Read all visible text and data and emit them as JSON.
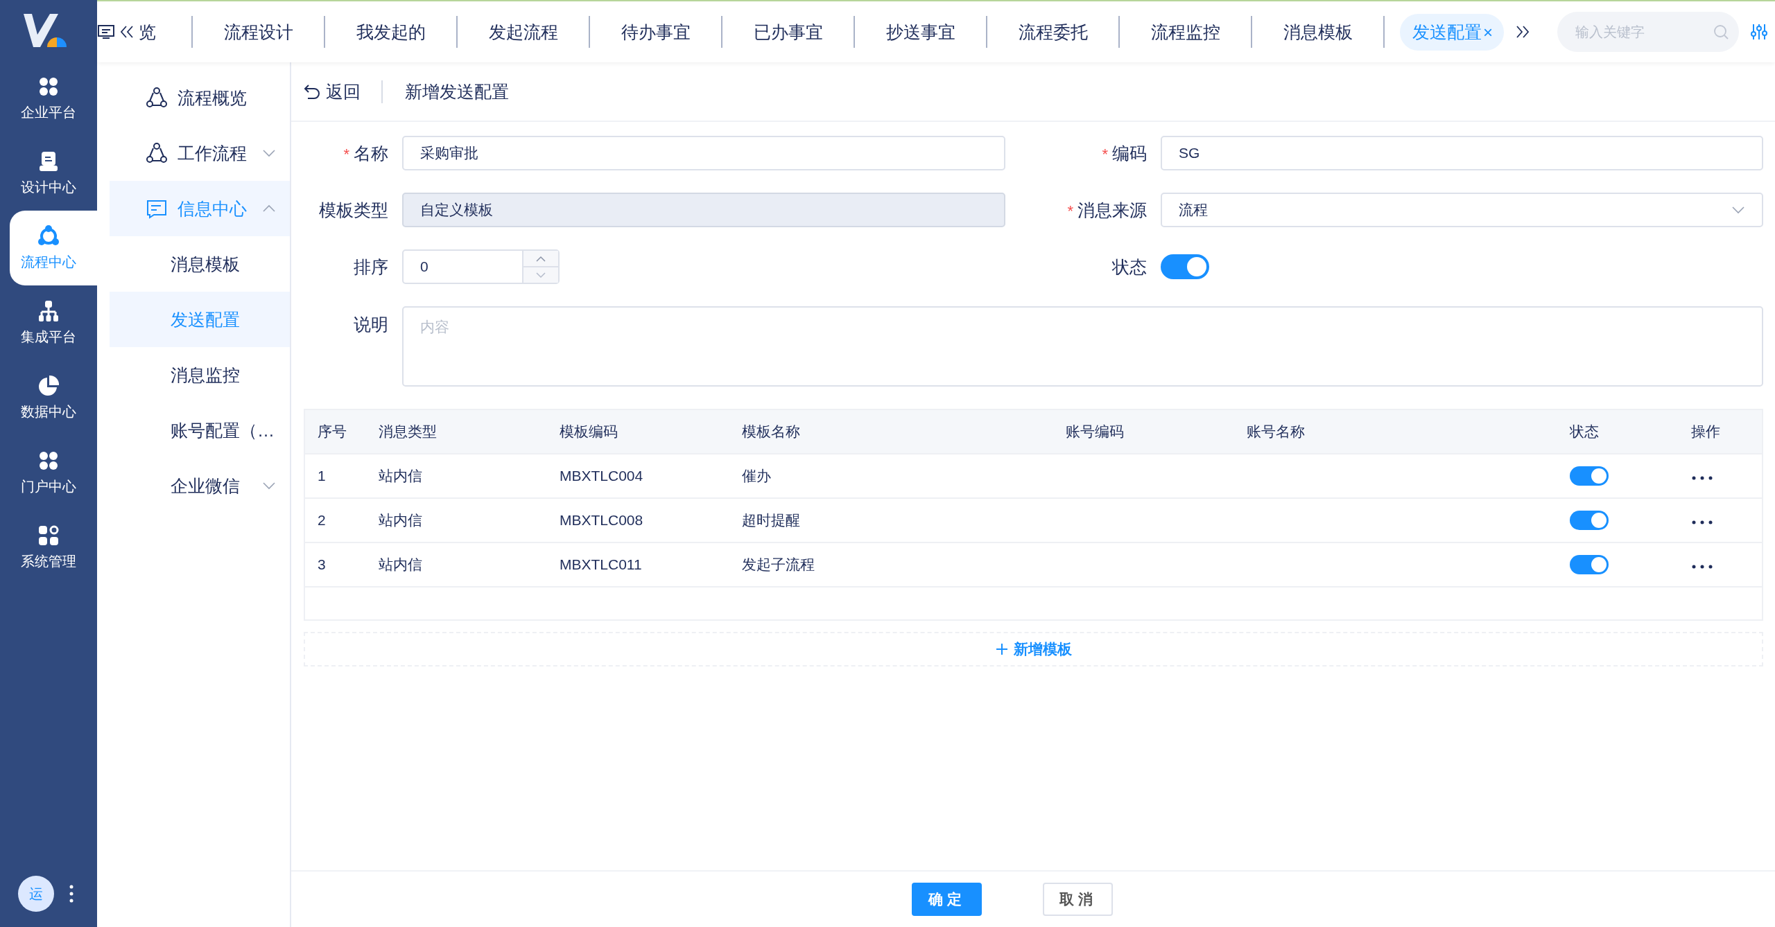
{
  "rail": {
    "items": [
      {
        "label": "企业平台",
        "kind": "grid",
        "selected": false
      },
      {
        "label": "设计中心",
        "kind": "design",
        "selected": false
      },
      {
        "label": "流程中心",
        "kind": "flow",
        "selected": true
      },
      {
        "label": "集成平台",
        "kind": "tree",
        "selected": false
      },
      {
        "label": "数据中心",
        "kind": "pie",
        "selected": false
      },
      {
        "label": "门户中心",
        "kind": "grid",
        "selected": false
      },
      {
        "label": "系统管理",
        "kind": "gear",
        "selected": false
      }
    ],
    "avatar": "运"
  },
  "tabs": [
    {
      "label": "览",
      "selected": false
    },
    {
      "label": "流程设计",
      "selected": false
    },
    {
      "label": "我发起的",
      "selected": false
    },
    {
      "label": "发起流程",
      "selected": false
    },
    {
      "label": "待办事宜",
      "selected": false
    },
    {
      "label": "已办事宜",
      "selected": false
    },
    {
      "label": "抄送事宜",
      "selected": false
    },
    {
      "label": "流程委托",
      "selected": false
    },
    {
      "label": "流程监控",
      "selected": false
    },
    {
      "label": "消息模板",
      "selected": false
    },
    {
      "label": "发送配置",
      "selected": true,
      "close": "×"
    }
  ],
  "search": {
    "placeholder": "输入关键字"
  },
  "menu": [
    {
      "label": "流程概览",
      "kind": "flow",
      "selected": false
    },
    {
      "label": "工作流程",
      "kind": "flow",
      "selected": false,
      "expanded": false
    },
    {
      "label": "信息中心",
      "kind": "message",
      "selected": true,
      "expanded": true,
      "children": [
        {
          "label": "消息模板",
          "selected": false
        },
        {
          "label": "发送配置",
          "selected": true
        },
        {
          "label": "消息监控",
          "selected": false
        },
        {
          "label": "账号配置（…",
          "selected": false
        },
        {
          "label": "企业微信",
          "selected": false,
          "expanded": false
        }
      ]
    }
  ],
  "breadcrumb": {
    "back": "返回",
    "title": "新增发送配置"
  },
  "form": {
    "fields": [
      {
        "label": "名称",
        "kind": "text",
        "required_mark": "*",
        "value": "采购审批",
        "disabled": false
      },
      {
        "label": "编码",
        "kind": "text",
        "required_mark": "*",
        "value": "SG",
        "disabled": false
      },
      {
        "label": "模板类型",
        "kind": "text",
        "value": "自定义模板",
        "disabled": true
      },
      {
        "label": "消息来源",
        "kind": "select",
        "required_mark": "*",
        "value": "流程"
      },
      {
        "label": "排序",
        "kind": "number",
        "value": "0"
      },
      {
        "label": "状态",
        "kind": "switch",
        "on": true
      },
      {
        "label": "说明",
        "kind": "textarea",
        "placeholder": "内容"
      }
    ]
  },
  "table": {
    "columns": [
      "序号",
      "消息类型",
      "模板编码",
      "模板名称",
      "账号编码",
      "账号名称",
      "状态",
      "操作"
    ],
    "rows": [
      {
        "cells": [
          "1",
          "站内信",
          "MBXTLC004",
          "催办",
          "",
          ""
        ],
        "on": true
      },
      {
        "cells": [
          "2",
          "站内信",
          "MBXTLC008",
          "超时提醒",
          "",
          ""
        ],
        "on": true
      },
      {
        "cells": [
          "3",
          "站内信",
          "MBXTLC011",
          "发起子流程",
          "",
          ""
        ],
        "on": true
      }
    ]
  },
  "add_button": {
    "label": "新增模板"
  },
  "footer": {
    "buttons": [
      {
        "label": "确定",
        "kind": "primary"
      },
      {
        "label": "取消",
        "kind": "default"
      }
    ]
  }
}
